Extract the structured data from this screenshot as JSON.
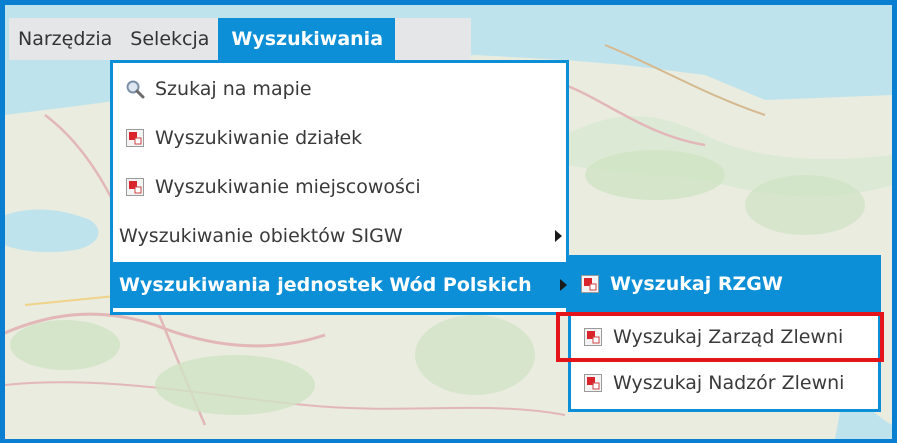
{
  "menubar": {
    "items": [
      {
        "label": "Narzędzia"
      },
      {
        "label": "Selekcja"
      },
      {
        "label": "Wyszukiwania"
      }
    ]
  },
  "dropdown": {
    "items": [
      {
        "label": "Szukaj na mapie",
        "icon": "magnifier-icon"
      },
      {
        "label": "Wyszukiwanie działek",
        "icon": "form-icon"
      },
      {
        "label": "Wyszukiwanie miejscowości",
        "icon": "form-icon"
      },
      {
        "label": "Wyszukiwanie obiektów SIGW",
        "icon": null,
        "has_submenu": true
      },
      {
        "label": "Wyszukiwania jednostek Wód Polskich",
        "icon": null,
        "has_submenu": true,
        "active": true
      }
    ]
  },
  "submenu": {
    "items": [
      {
        "label": "Wyszukaj RZGW",
        "icon": "form-icon"
      },
      {
        "label": "Wyszukaj Zarząd Zlewni",
        "icon": "form-icon",
        "annotated": true
      },
      {
        "label": "Wyszukaj Nadzór Zlewni",
        "icon": "form-icon"
      }
    ]
  },
  "colors": {
    "accent": "#0c8fd6",
    "frame": "#0a7fd1",
    "annotation": "#e4141b",
    "menubar_bg": "#e4e6e8"
  }
}
